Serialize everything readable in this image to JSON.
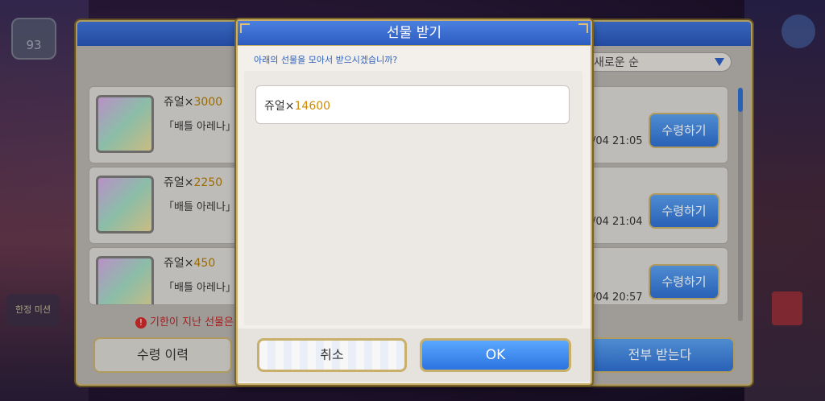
{
  "background": {
    "level_value": "93",
    "side_label": "한정 미션"
  },
  "gift_box": {
    "sort_label": "새로운 순",
    "items": [
      {
        "name": "쥬얼×",
        "qty": "3000",
        "desc": "「배틀 아레나」어",
        "date": "/04 21:05",
        "button": "수령하기"
      },
      {
        "name": "쥬얼×",
        "qty": "2250",
        "desc": "「배틀 아레나」어",
        "date": "/04 21:04",
        "button": "수령하기"
      },
      {
        "name": "쥬얼×",
        "qty": "450",
        "desc": "「배틀 아레나」어",
        "date": "/04 20:57",
        "button": "수령하기"
      }
    ],
    "expired_note": "기한이 지난 선물은",
    "history_button": "수령 이력",
    "receive_all_button": "전부 받는다"
  },
  "modal": {
    "title": "선물 받기",
    "subtitle": "아래의 선물을 모아서 받으시겠습니까?",
    "item_name": "쥬얼×",
    "item_qty": "14600",
    "cancel_label": "취소",
    "ok_label": "OK"
  },
  "colors": {
    "accent_blue": "#2f6fd0",
    "gold_border": "#c9b06a",
    "quantity_orange": "#d08a00"
  }
}
